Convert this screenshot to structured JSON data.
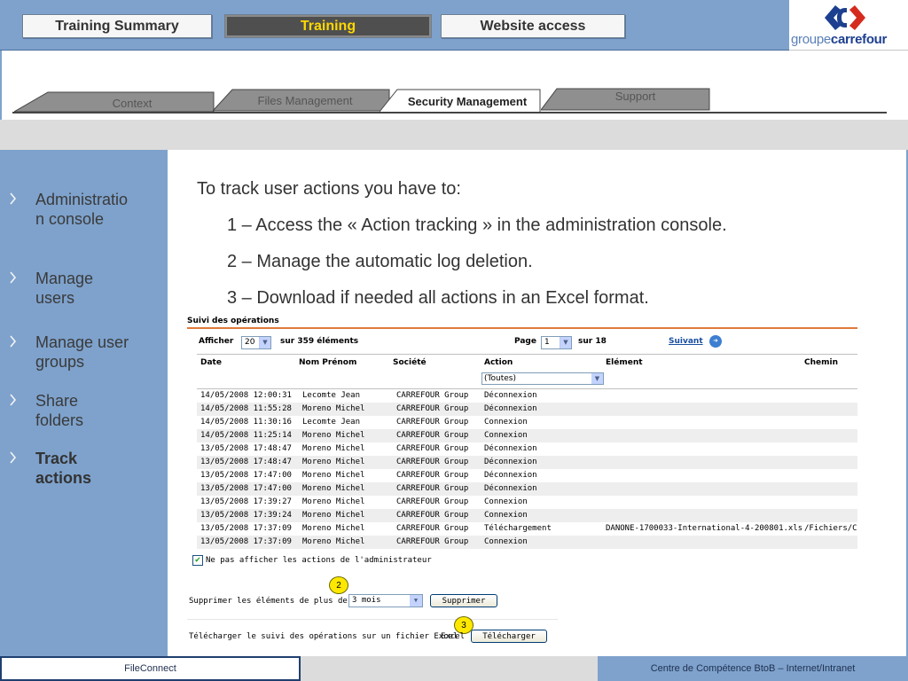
{
  "top_nav": {
    "buttons": [
      {
        "label": "Training Summary"
      },
      {
        "label": "Training"
      },
      {
        "label": "Website access"
      }
    ]
  },
  "logo": {
    "text_light": "groupe",
    "text_bold": "carrefour"
  },
  "tabs": [
    {
      "label": "Context"
    },
    {
      "label": "Files Management"
    },
    {
      "label": "Security Management"
    },
    {
      "label": "Support"
    }
  ],
  "sidebar": {
    "items": [
      {
        "label": "Administration console"
      },
      {
        "label": "Manage users"
      },
      {
        "label": "Manage user groups"
      },
      {
        "label": "Share folders"
      },
      {
        "label": "Track actions"
      }
    ]
  },
  "content": {
    "intro": "To track user actions you have to:",
    "steps": [
      "1 – Access the « Action tracking » in the administration console.",
      "2 – Manage the automatic log deletion.",
      "3 – Download if needed all actions in an Excel format."
    ]
  },
  "screenshot": {
    "title": "Suivi des opérations",
    "afficher_label": "Afficher",
    "afficher_value": "20",
    "count_text": "sur 359 éléments",
    "page_label": "Page",
    "page_value": "1",
    "page_total": "sur 18",
    "next_label": "Suivant",
    "columns": [
      "Date",
      "Nom Prénom",
      "Société",
      "Action",
      "Elément",
      "Chemin"
    ],
    "action_filter": "(Toutes)",
    "rows": [
      [
        "14/05/2008 12:00:31",
        "Lecomte Jean",
        "CARREFOUR Group",
        "Déconnexion",
        "",
        ""
      ],
      [
        "14/05/2008 11:55:28",
        "Moreno Michel",
        "CARREFOUR Group",
        "Déconnexion",
        "",
        ""
      ],
      [
        "14/05/2008 11:30:16",
        "Lecomte Jean",
        "CARREFOUR Group",
        "Connexion",
        "",
        ""
      ],
      [
        "14/05/2008 11:25:14",
        "Moreno Michel",
        "CARREFOUR Group",
        "Connexion",
        "",
        ""
      ],
      [
        "13/05/2008 17:48:47",
        "Moreno Michel",
        "CARREFOUR Group",
        "Déconnexion",
        "",
        ""
      ],
      [
        "13/05/2008 17:48:47",
        "Moreno Michel",
        "CARREFOUR Group",
        "Déconnexion",
        "",
        ""
      ],
      [
        "13/05/2008 17:47:00",
        "Moreno Michel",
        "CARREFOUR Group",
        "Déconnexion",
        "",
        ""
      ],
      [
        "13/05/2008 17:47:00",
        "Moreno Michel",
        "CARREFOUR Group",
        "Déconnexion",
        "",
        ""
      ],
      [
        "13/05/2008 17:39:27",
        "Moreno Michel",
        "CARREFOUR Group",
        "Connexion",
        "",
        ""
      ],
      [
        "13/05/2008 17:39:24",
        "Moreno Michel",
        "CARREFOUR Group",
        "Connexion",
        "",
        ""
      ],
      [
        "13/05/2008 17:37:09",
        "Moreno Michel",
        "CARREFOUR Group",
        "Téléchargement",
        "DANONE-1700033-International-4-200801.xls",
        "/Fichiers/Carr"
      ],
      [
        "13/05/2008 17:37:09",
        "Moreno Michel",
        "CARREFOUR Group",
        "Connexion",
        "",
        ""
      ]
    ],
    "hide_admin_label": "Ne pas afficher les actions de l'administrateur",
    "hide_admin_checked": true,
    "delete_label": "Supprimer les éléments de plus de",
    "delete_value": "3 mois",
    "delete_button": "Supprimer",
    "download_label": "Télécharger le suivi des opérations sur un fichier Excel",
    "download_format": "Excel",
    "download_button": "Télécharger",
    "badge_2": "2",
    "badge_3": "3"
  },
  "footer": {
    "left": "FileConnect",
    "right": "Centre de Compétence BtoB – Internet/Intranet"
  },
  "colors": {
    "nav_blue": "#7ea2cc",
    "active_tab_text": "#ffd800",
    "rule_orange": "#e07a3a",
    "badge_yellow": "#ffe800"
  }
}
